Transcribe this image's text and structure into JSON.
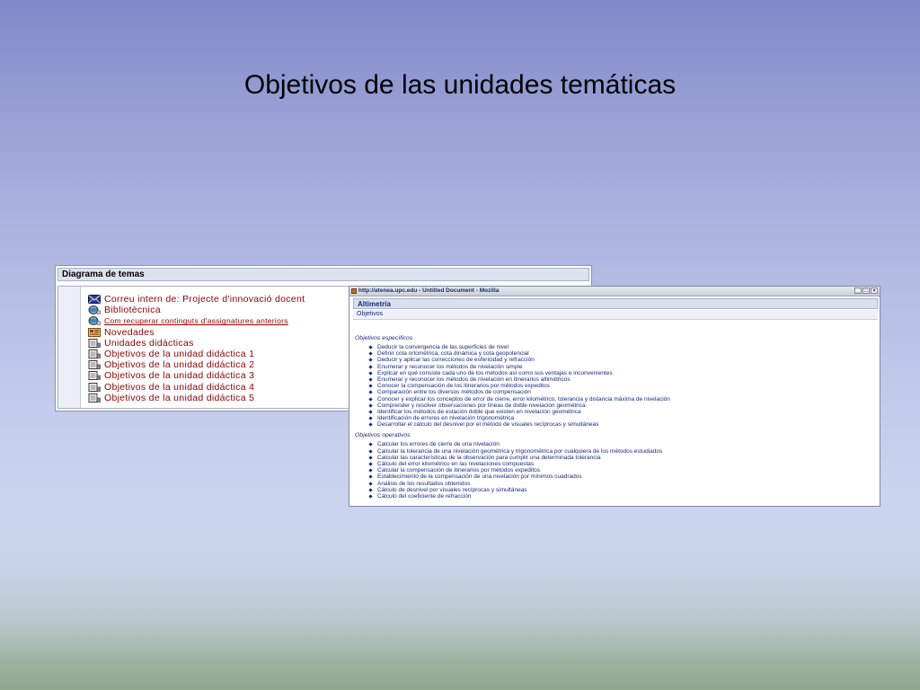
{
  "slide": {
    "title": "Objetivos de las unidades temáticas"
  },
  "diagram_panel": {
    "header": "Diagrama de temas",
    "items": [
      {
        "label": "Correu intern de: Projecte d'innovació docent",
        "icon": "mail-icon"
      },
      {
        "label": "Bibliotècnica",
        "icon": "globe-icon"
      },
      {
        "label": "Com recuperar continguts d'assignatures anteriors",
        "icon": "globe-icon"
      },
      {
        "label": "Novedades",
        "icon": "news-icon"
      },
      {
        "label": "Unidades didácticas",
        "icon": "document-icon"
      },
      {
        "label": "Objetivos de la unidad didáctica 1",
        "icon": "document-icon"
      },
      {
        "label": "Objetivos de la unidad didáctica 2",
        "icon": "document-icon"
      },
      {
        "label": "Objetivos de la unidad didáctica 3",
        "icon": "document-icon"
      },
      {
        "label": "Objetivos de la unidad didáctica 4",
        "icon": "document-icon"
      },
      {
        "label": "Objetivos de la unidad didáctica 5",
        "icon": "document-icon"
      }
    ]
  },
  "browser_window": {
    "title": "http://atenea.upc.edu - Untitled Document - Mozilla",
    "header": "Altimetría",
    "tab": "Objetivos",
    "especificos_title": "Objetivos específicos",
    "especificos": [
      "Deducir la convergencia de las superficies de nivel",
      "Definir cota ortométrica, cota dinámica y cota geopotencial",
      "Deducir y aplicar las correcciones de esfericidad y refracción",
      "Enumerar y reconocer los métodos de nivelación simple",
      "Explicar en qué consiste cada uno de los métodos así como sus ventajas e inconvenientes",
      "Enumerar y reconocer los métodos de nivelación en itinerarios altimétricos",
      "Conocer la compensación de los itinerarios por métodos expeditos",
      "Comparación entre los diversos métodos de compensación",
      "Conocer y explicar los conceptos de error de cierre, error kilométrico, tolerancia y distancia máxima de nivelación",
      "Comprender y resolver observaciones por líneas de doble nivelación geométrica",
      "Identificar los métodos de estación doble que existen en nivelación geométrica",
      "Identificación de errores en nivelación trigonométrica",
      "Desarrollar el cálculo del desnivel por el método de visuales recíprocas y simultáneas"
    ],
    "operativos_title": "Objetivos operativos",
    "operativos": [
      "Calcular los errores de cierre de una nivelación",
      "Calcular la tolerancia de una nivelación geométrica y trigonométrica por cualquiera de los métodos estudiados",
      "Calcular las características de la observación para cumplir una determinada tolerancia",
      "Cálculo del error kilométrico en las nivelaciones compuestas",
      "Calcular la compensación de itinerarios por métodos expeditos",
      "Establecimiento de la compensación de una nivelación por mínimos cuadrados",
      "Análisis de los resultados obtenidos",
      "Cálculo de desnivel por visuales recíprocas y simultáneas",
      "Cálculo del coeficiente de refracción"
    ]
  }
}
